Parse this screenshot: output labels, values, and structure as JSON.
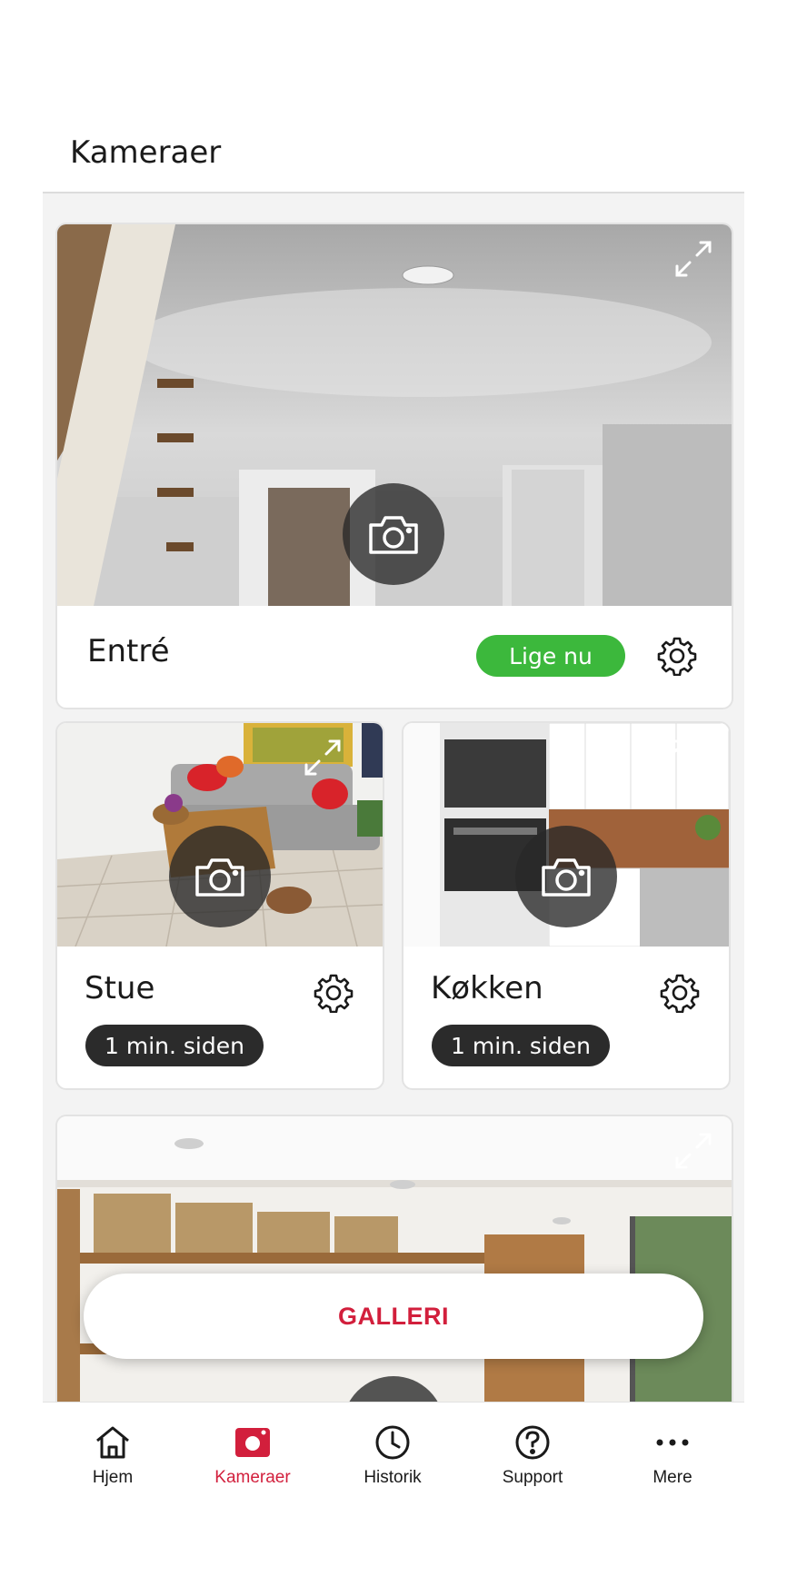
{
  "header": {
    "title": "Kameraer"
  },
  "cameras": [
    {
      "name": "Entré",
      "status": "Lige nu",
      "status_type": "live"
    },
    {
      "name": "Stue",
      "status": "1 min. siden",
      "status_type": "recent"
    },
    {
      "name": "Køkken",
      "status": "1 min. siden",
      "status_type": "recent"
    }
  ],
  "gallery": {
    "label": "GALLERI"
  },
  "tabs": [
    {
      "label": "Hjem",
      "icon": "home-icon",
      "active": false
    },
    {
      "label": "Kameraer",
      "icon": "camera-icon",
      "active": true
    },
    {
      "label": "Historik",
      "icon": "clock-icon",
      "active": false
    },
    {
      "label": "Support",
      "icon": "help-icon",
      "active": false
    },
    {
      "label": "Mere",
      "icon": "more-icon",
      "active": false
    }
  ],
  "colors": {
    "accent": "#d21f3c",
    "live_badge": "#3cb83c",
    "time_badge": "#2b2b2b",
    "feed_background": "#f3f3f3"
  }
}
